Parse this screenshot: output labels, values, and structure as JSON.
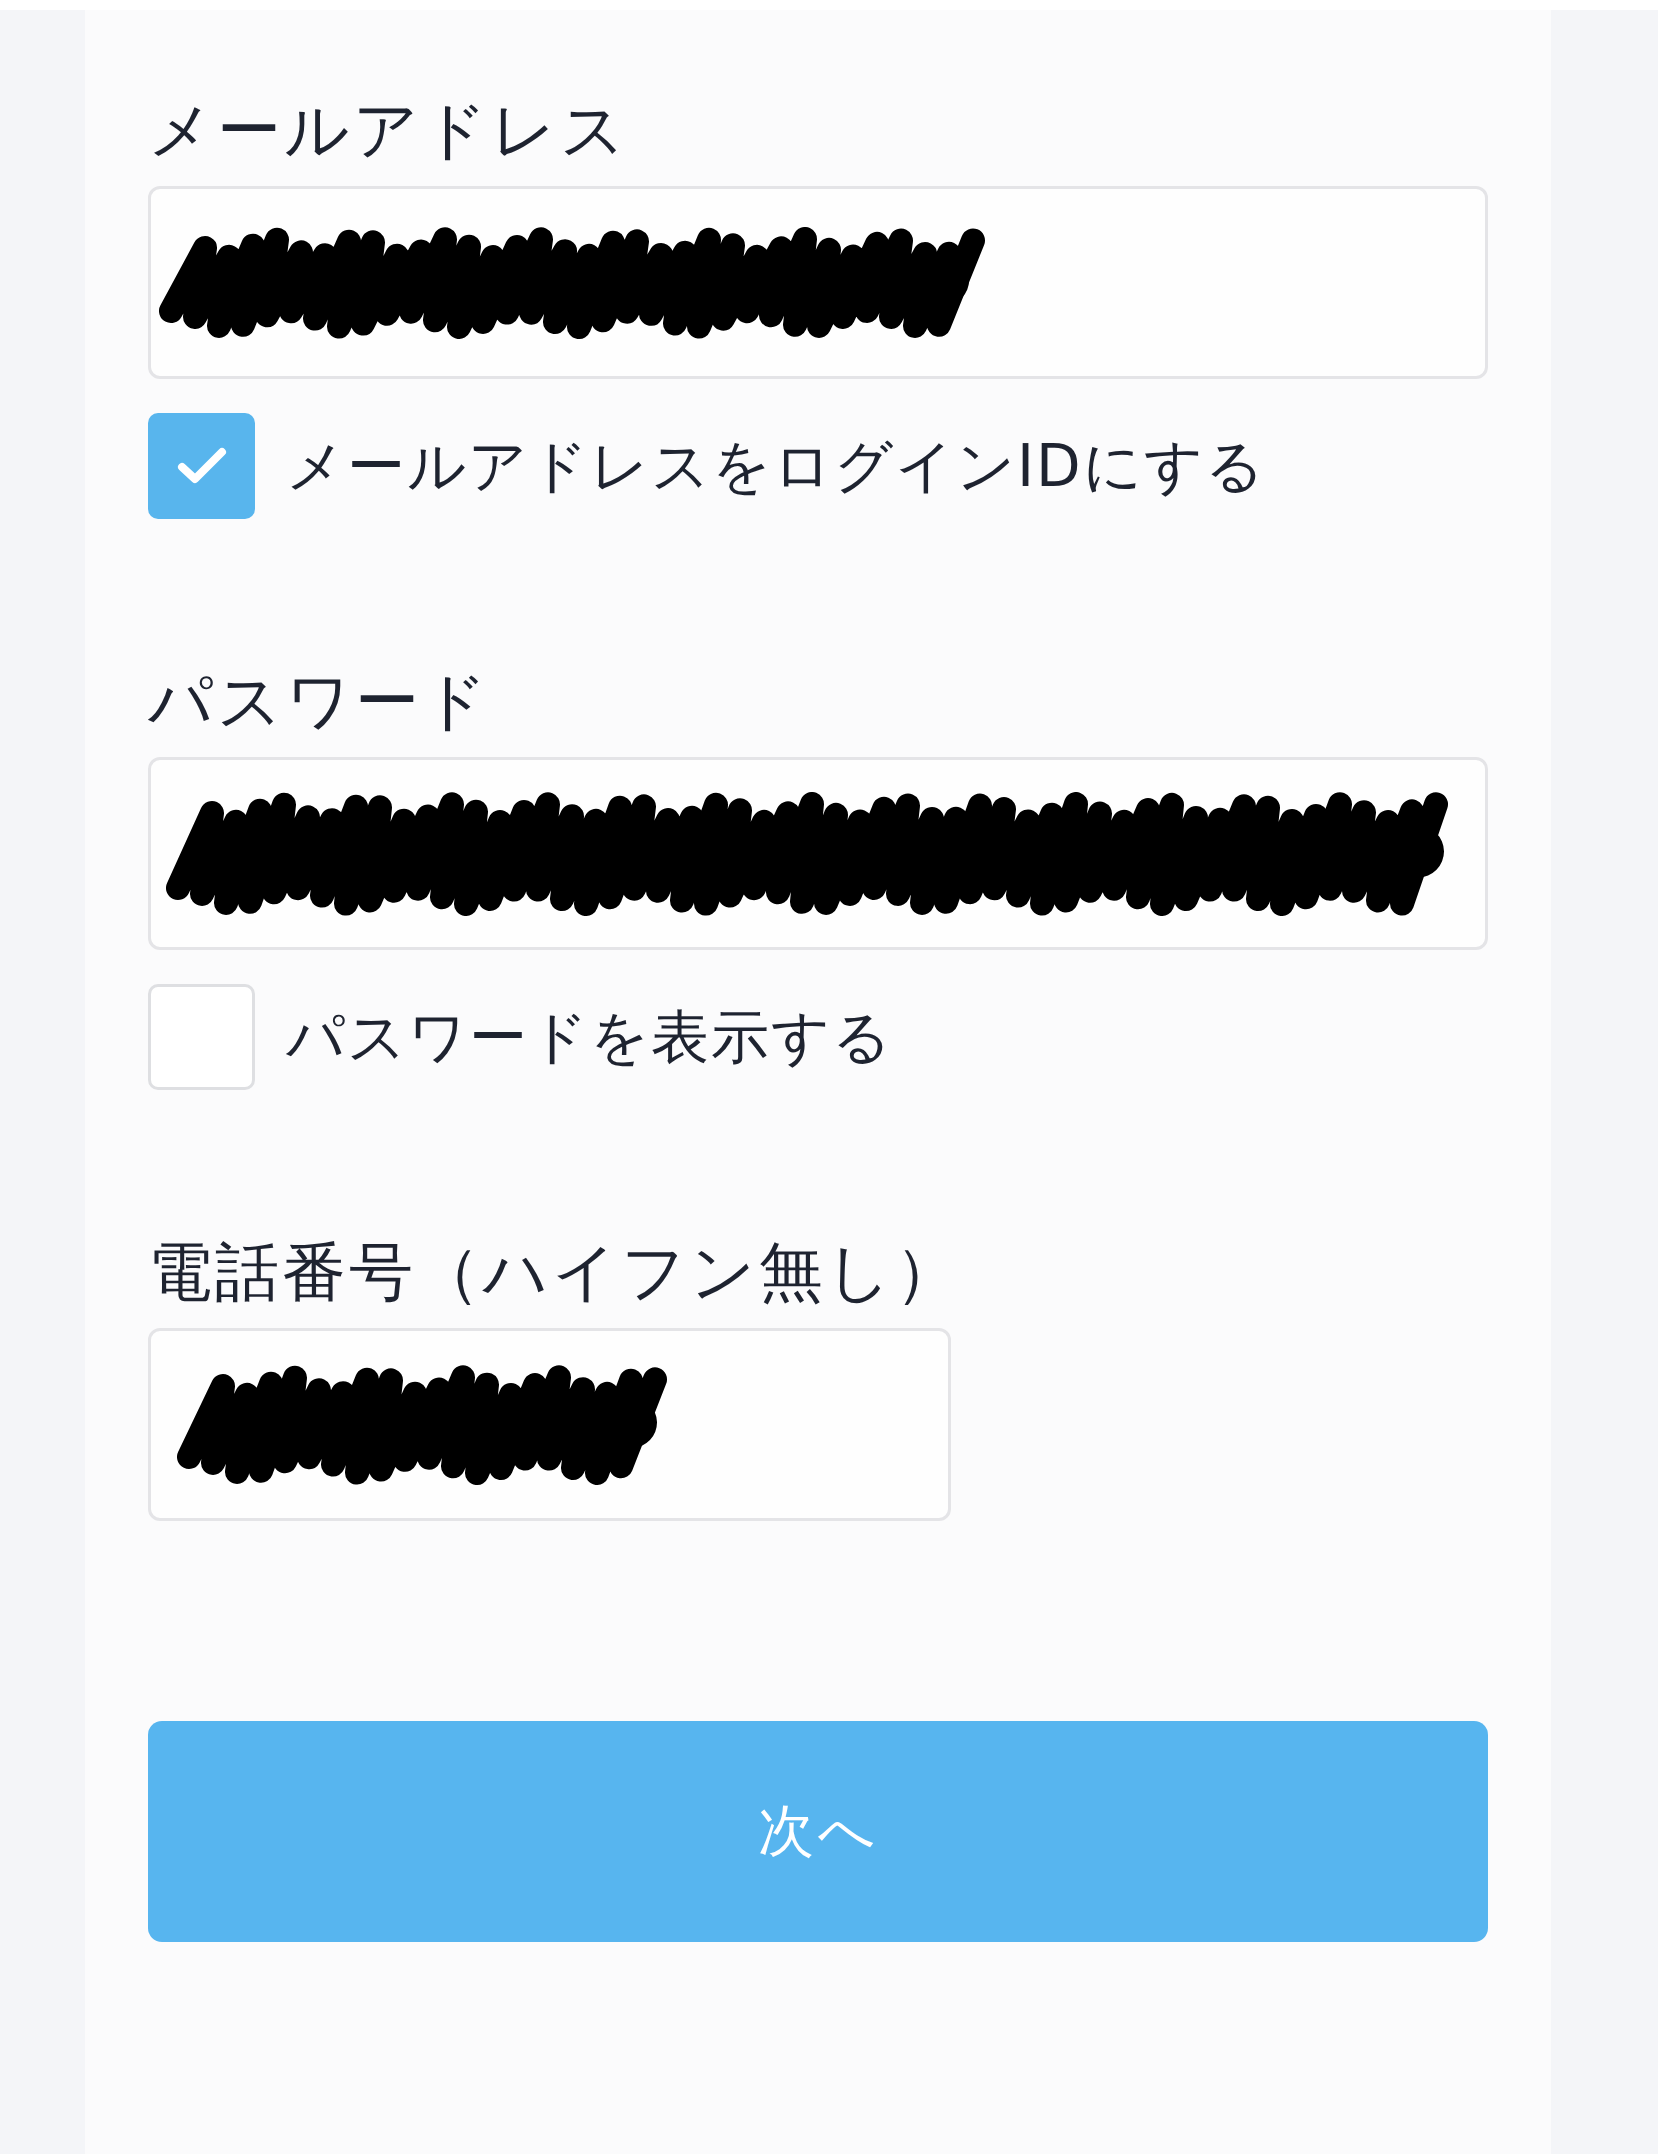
{
  "form": {
    "fields": [
      {
        "kind": "email",
        "label": "メールアドレス",
        "input": {
          "redacted": true
        },
        "checkbox": {
          "label": "メールアドレスをログインIDにする",
          "checked": true
        }
      },
      {
        "kind": "password",
        "label": "パスワード",
        "input": {
          "redacted": true
        },
        "checkbox": {
          "label": "パスワードを表示する",
          "checked": false
        }
      },
      {
        "kind": "phone",
        "label": "電話番号（ハイフン無し）",
        "input": {
          "redacted": true
        }
      }
    ],
    "submit_button": {
      "label": "次へ"
    }
  }
}
